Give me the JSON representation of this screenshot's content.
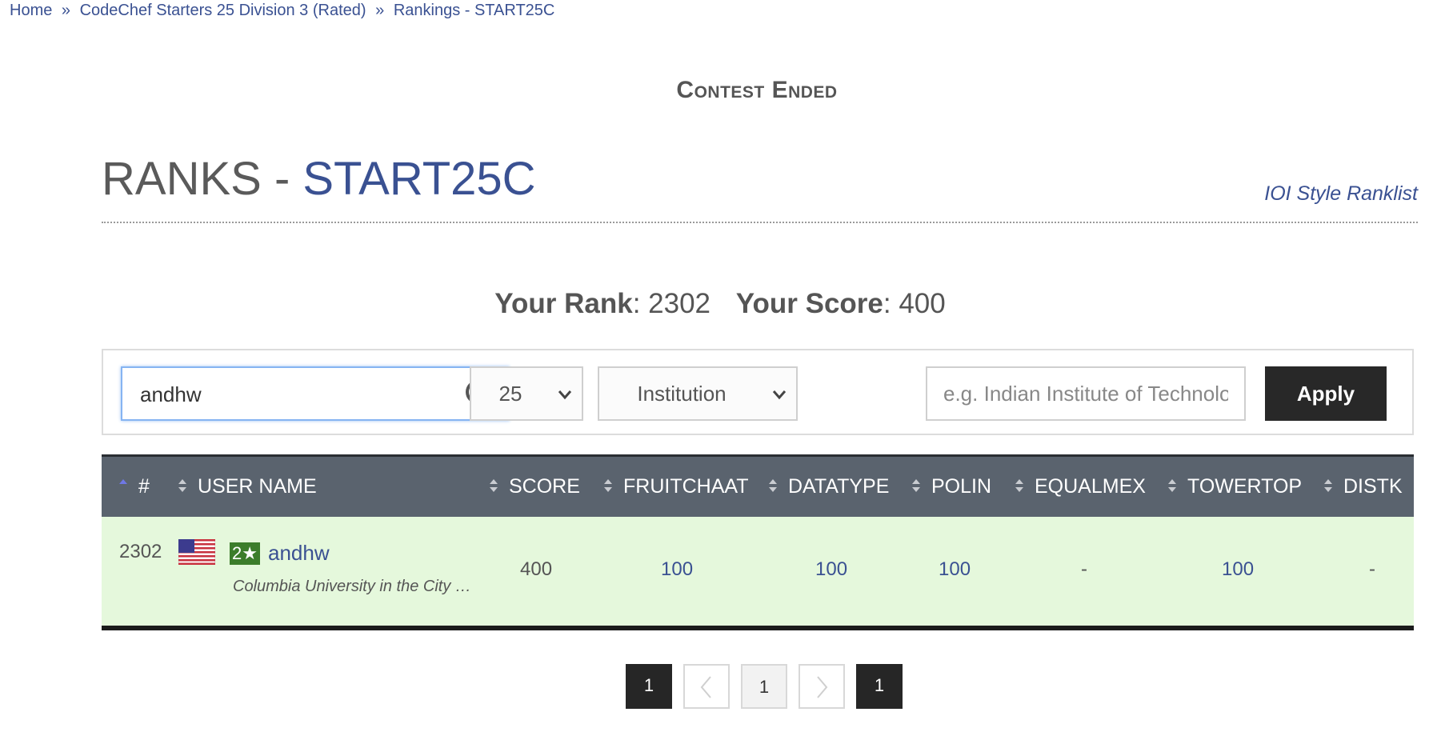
{
  "breadcrumb": {
    "home": "Home",
    "sep": "»",
    "contest": "CodeChef Starters 25 Division 3 (Rated)",
    "rankings": "Rankings - START25C"
  },
  "status": "Contest Ended",
  "title": {
    "prefix": "RANKS - ",
    "code": "START25C"
  },
  "ioi_link": "IOI Style Ranklist",
  "summary": {
    "rank_label": "Your Rank",
    "rank_value": "2302",
    "score_label": "Your Score",
    "score_value": "400"
  },
  "filters": {
    "search_value": "andhw",
    "page_size": "25",
    "filter_type": "Institution",
    "institution_placeholder": "e.g. Indian Institute of Technology",
    "apply_label": "Apply"
  },
  "table": {
    "headers": [
      "#",
      "USER NAME",
      "SCORE",
      "FRUITCHAAT",
      "DATATYPE",
      "POLIN",
      "EQUALMEX",
      "TOWERTOP",
      "DISTK"
    ],
    "row": {
      "rank": "2302",
      "stars": "2★",
      "username": "andhw",
      "institution": "Columbia University in the City …",
      "score": "400",
      "problems": [
        "100",
        "100",
        "100",
        "-",
        "100",
        "-"
      ]
    }
  },
  "pagination": {
    "first": "1",
    "current": "1",
    "last": "1"
  },
  "colors": {
    "link": "#3a5192",
    "header_bg": "#5a636e",
    "row_bg": "#e5f8dc",
    "star_green": "#3c7d2b"
  },
  "icons": [
    "search-icon",
    "chevron-down-icon",
    "sort-icon",
    "flag-usa-icon",
    "chevron-left-icon",
    "chevron-right-icon"
  ]
}
